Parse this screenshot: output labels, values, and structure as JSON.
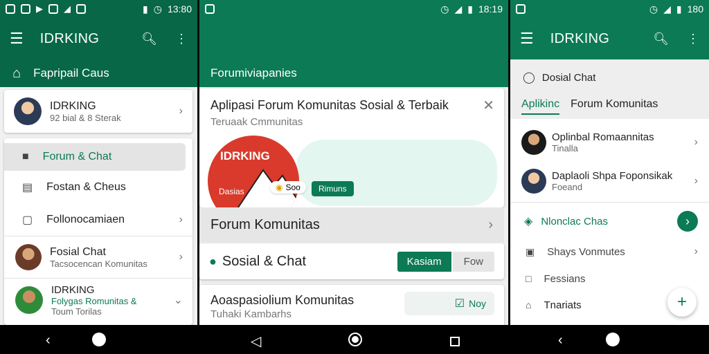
{
  "colors": {
    "brand": "#0b7a55",
    "brand_dark": "#076746",
    "accent_red": "#d93a2b"
  },
  "panel1": {
    "status": {
      "time": "13:80"
    },
    "toolbar": {
      "title": "IDRKING"
    },
    "subbar": {
      "label": "Fapripail Caus"
    },
    "profile": {
      "name": "IDRKING",
      "subtitle": "92 bial & 8 Sterak"
    },
    "menu": [
      {
        "label": "Forum & Chat",
        "icon": "folder-icon",
        "active": true
      },
      {
        "label": "Fostan & Cheus",
        "icon": "list-icon",
        "active": false
      },
      {
        "label": "Follonocamiaen",
        "icon": "chat-icon",
        "active": false
      }
    ],
    "chats": [
      {
        "title": "Fosial Chat",
        "subtitle": "Tacsocencan Komunitas"
      },
      {
        "title": "IDRKING",
        "subtitle": "Folygas Romunitas &",
        "subtitle2": "Toum Torilas"
      }
    ]
  },
  "panel2": {
    "status": {
      "time": "18:19"
    },
    "subbar": {
      "label": "Forumiviapanies"
    },
    "card": {
      "title": "Aplipasi Forum Komunitas Sosial & Terbaik",
      "subtitle": "Teruaak Cmmunitas",
      "logo_text": "IDRKING",
      "logo_sub": "Dasias",
      "badge1": "Soo",
      "badge2": "Rimuns"
    },
    "forum_row": "Forum Komunitas",
    "sosial": {
      "label": "Sosial & Chat",
      "btn_primary": "Kasiam",
      "btn_secondary": "Fow"
    },
    "bottom": {
      "title": "Aoaspasiolium Komunitas",
      "subtitle": "Tuhaki Kambarhs",
      "btn": "Noy"
    }
  },
  "panel3": {
    "status": {
      "time": "180"
    },
    "toolbar": {
      "title": "IDRKING"
    },
    "header": {
      "label": "Dosial Chat"
    },
    "tabs": [
      {
        "label": "Aplikinc",
        "active": true
      },
      {
        "label": "Forum Komunitas",
        "active": false
      }
    ],
    "contacts": [
      {
        "title": "Oplinbal Romaannitas",
        "subtitle": "Tinalla"
      },
      {
        "title": "Daplaoli Shpa Foponsikak",
        "subtitle": "Foeand"
      }
    ],
    "section": {
      "label": "Nlonclac Chas"
    },
    "links": [
      {
        "label": "Shays Vonmutes",
        "icon": "window-icon",
        "chevron": true
      },
      {
        "label": "Fessians",
        "icon": "message-icon",
        "chevron": false
      },
      {
        "label": "Tnariats",
        "icon": "tag-icon",
        "chevron": false
      }
    ]
  }
}
